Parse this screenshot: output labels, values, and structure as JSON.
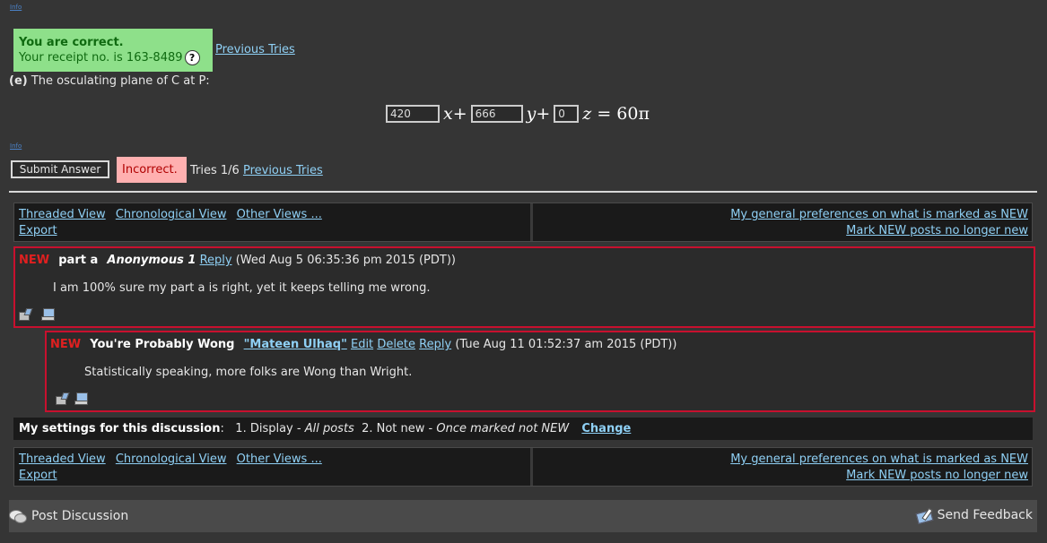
{
  "part_d": {
    "info_link": "Info",
    "result_title": "You are correct.",
    "receipt_text": "Your receipt no. is 163-8489",
    "help_icon": "?",
    "previous_tries": "Previous Tries"
  },
  "part_e": {
    "label": "(e)",
    "question": "The osculating plane of C at P:",
    "inputs": [
      "420",
      "666",
      "0"
    ],
    "x_term": "x+",
    "y_term": "y+",
    "z_term": "z",
    "rhs": "= 60π",
    "info_link": "Info",
    "submit_label": "Submit Answer",
    "status": "Incorrect.",
    "tries": "Tries 1/6",
    "previous_tries": "Previous Tries"
  },
  "nav": {
    "threaded": "Threaded View",
    "chronological": "Chronological View",
    "other": "Other Views ...",
    "export": "Export",
    "prefs": "My general preferences on what is marked as NEW",
    "mark_new": "Mark NEW posts no longer new"
  },
  "posts": [
    {
      "new": "NEW",
      "subject": "part a",
      "author": "Anonymous 1",
      "reply": "Reply",
      "date": "(Wed Aug 5 06:35:36 pm 2015 (PDT))",
      "body": "I am 100% sure my part a is right, yet it keeps telling me wrong."
    },
    {
      "new": "NEW",
      "subject": "You're Probably Wong",
      "author": "\"Mateen Ulhaq\"",
      "edit": "Edit",
      "delete": "Delete",
      "reply": "Reply",
      "date": "(Tue Aug 11 01:52:37 am 2015 (PDT))",
      "body": "Statistically speaking, more folks are Wong than Wright."
    }
  ],
  "settings": {
    "label": "My settings for this discussion",
    "display_label": "1. Display -",
    "display_value": "All posts",
    "notnew_label": "2. Not new -",
    "notnew_value": "Once marked not NEW",
    "change": "Change"
  },
  "footer": {
    "post_discussion": "Post Discussion",
    "send_feedback": "Send Feedback"
  },
  "colors": {
    "background": "#353535",
    "correct_bg": "#8ee08a",
    "incorrect_bg": "#ffb0b0",
    "new_border": "#c8102e",
    "link": "#8fd0f5"
  }
}
